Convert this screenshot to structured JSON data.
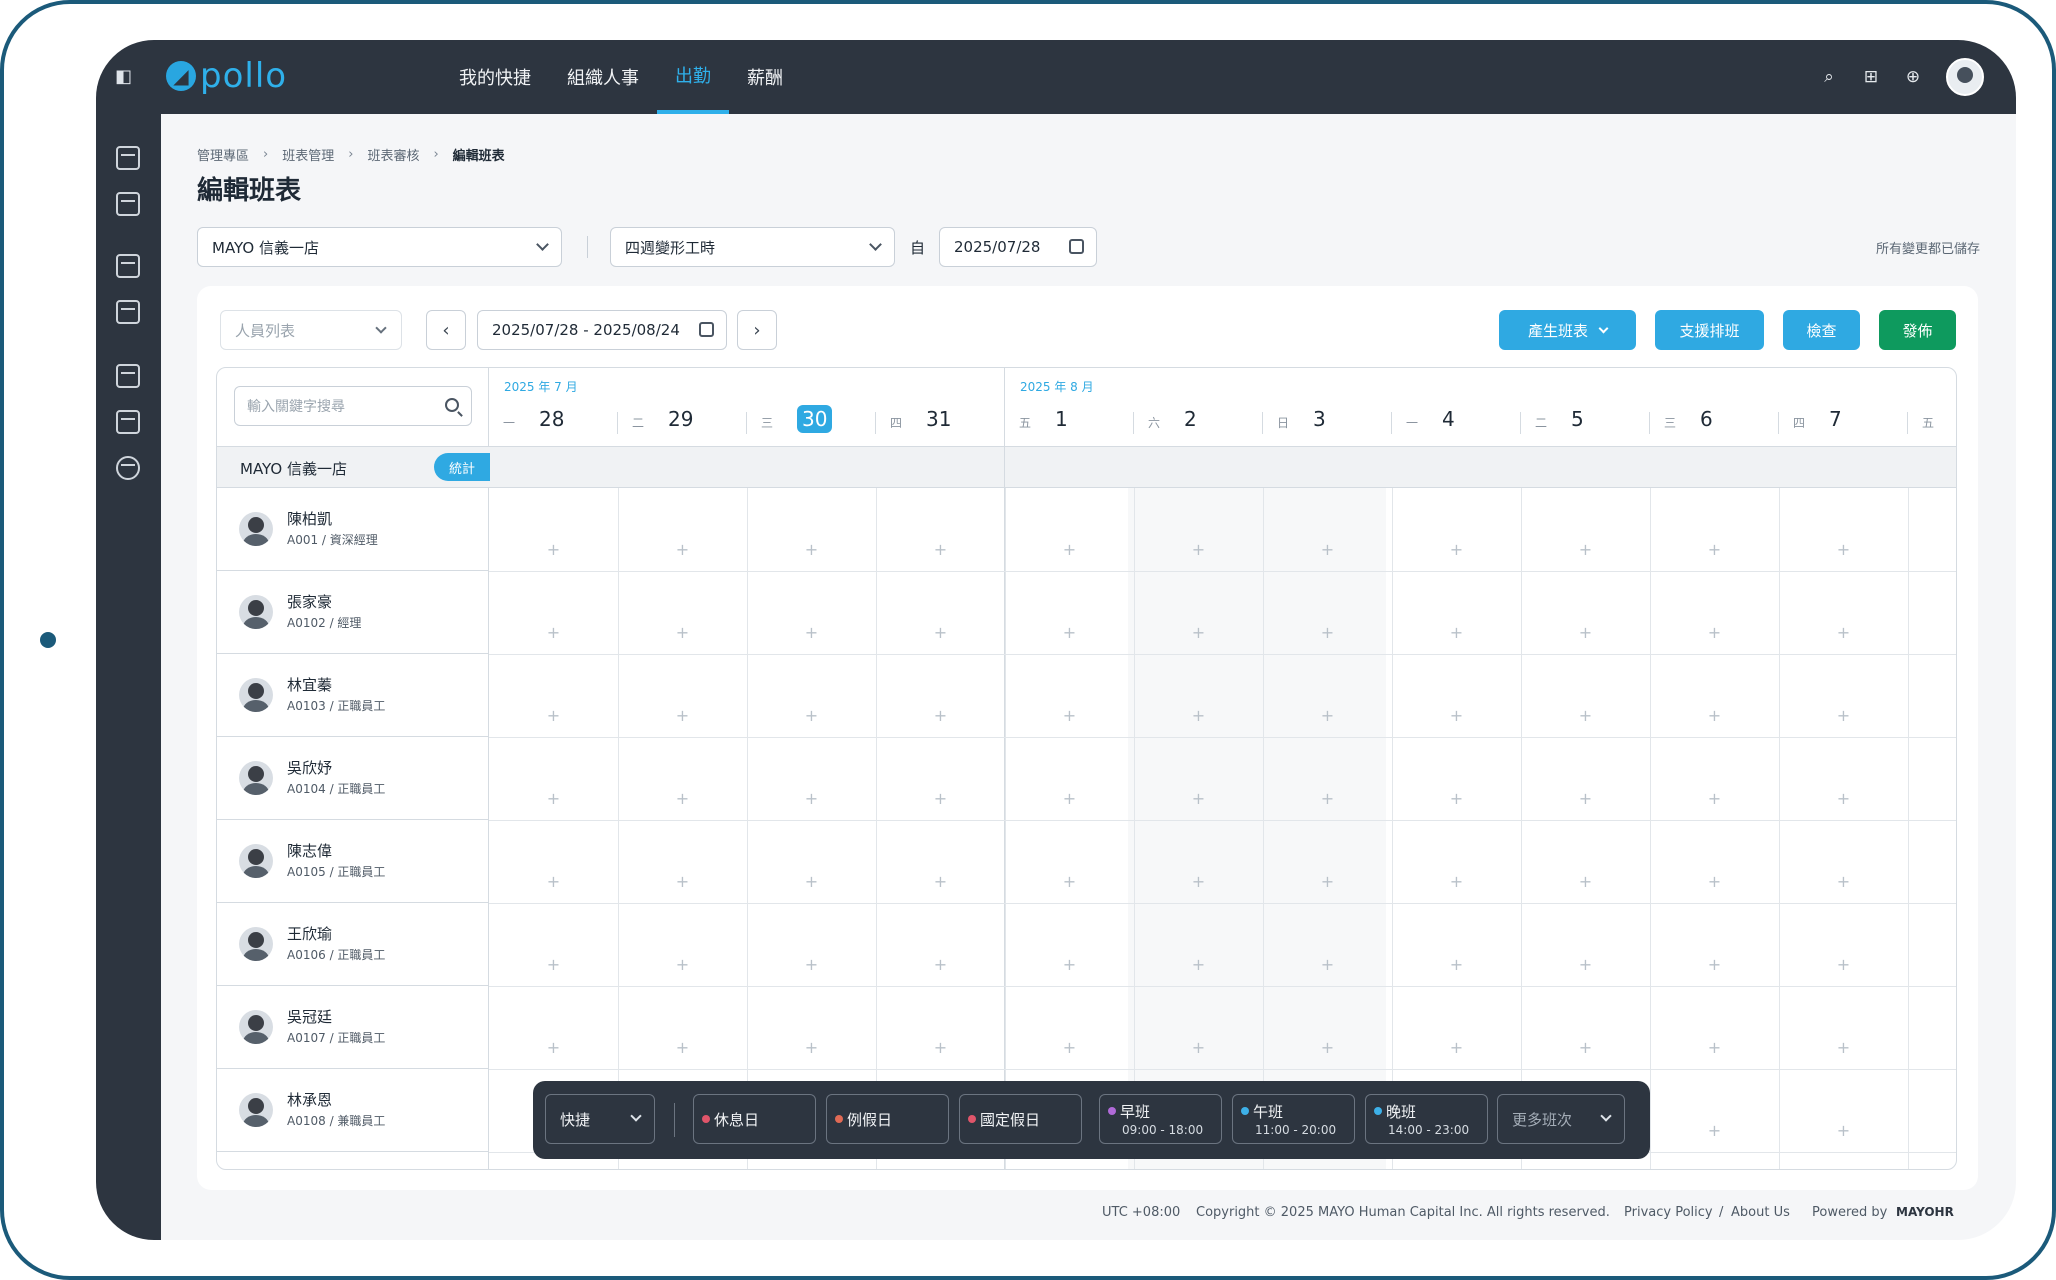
{
  "app": {
    "logo_text": "pollo",
    "brand_color": "#2fa9e2"
  },
  "nav": {
    "items": [
      {
        "label": "我的快捷"
      },
      {
        "label": "組織人事"
      },
      {
        "label": "出勤",
        "active": true
      },
      {
        "label": "薪酬"
      }
    ]
  },
  "breadcrumb": [
    "管理專區",
    "班表管理",
    "班表審核",
    "編輯班表"
  ],
  "page_title": "編輯班表",
  "filters": {
    "store": "MAYO 信義一店",
    "work_type": "四週變形工時",
    "from_label": "自",
    "from_date": "2025/07/28",
    "saved_status": "所有變更都已儲存"
  },
  "toolbar": {
    "people_select_placeholder": "人員列表",
    "date_range": "2025/07/28 - 2025/08/24",
    "generate_label": "產生班表",
    "support_label": "支援排班",
    "check_label": "檢查",
    "publish_label": "發佈"
  },
  "grid": {
    "search_placeholder": "輸入關鍵字搜尋",
    "group_name": "MAYO 信義一店",
    "stats_label": "統計",
    "month_labels": [
      "2025 年 7 月",
      "2025 年 8 月"
    ],
    "days": [
      {
        "weekday": "一",
        "day": "28"
      },
      {
        "weekday": "二",
        "day": "29"
      },
      {
        "weekday": "三",
        "day": "30",
        "today": true
      },
      {
        "weekday": "四",
        "day": "31"
      },
      {
        "weekday": "五",
        "day": "1"
      },
      {
        "weekday": "六",
        "day": "2"
      },
      {
        "weekday": "日",
        "day": "3"
      },
      {
        "weekday": "一",
        "day": "4"
      },
      {
        "weekday": "二",
        "day": "5"
      },
      {
        "weekday": "三",
        "day": "6"
      },
      {
        "weekday": "四",
        "day": "7"
      },
      {
        "weekday": "五",
        "day": ""
      }
    ],
    "employees": [
      {
        "name": "陳柏凱",
        "meta": "A001 / 資深經理"
      },
      {
        "name": "張家豪",
        "meta": "A0102 / 經理"
      },
      {
        "name": "林宜蓁",
        "meta": "A0103 / 正職員工"
      },
      {
        "name": "吳欣妤",
        "meta": "A0104 / 正職員工"
      },
      {
        "name": "陳志偉",
        "meta": "A0105 / 正職員工"
      },
      {
        "name": "王欣瑜",
        "meta": "A0106 / 正職員工"
      },
      {
        "name": "吳冠廷",
        "meta": "A0107 / 正職員工"
      },
      {
        "name": "林承恩",
        "meta": "A0108 / 兼職員工"
      }
    ],
    "add_symbol": "+"
  },
  "quickbar": {
    "mode_label": "快捷",
    "items": [
      {
        "label": "休息日",
        "dot_color": "#e0556a"
      },
      {
        "label": "例假日",
        "dot_color": "#e06a55"
      },
      {
        "label": "國定假日",
        "dot_color": "#e0556a"
      },
      {
        "label": "早班",
        "time": "09:00 - 18:00",
        "dot_color": "#b06ad8"
      },
      {
        "label": "午班",
        "time": "11:00 - 20:00",
        "dot_color": "#3db0e8"
      },
      {
        "label": "晚班",
        "time": "14:00 - 23:00",
        "dot_color": "#3db0e8"
      }
    ],
    "more_label": "更多班次"
  },
  "footer": {
    "timezone": "UTC +08:00",
    "copyright": "Copyright © 2025 MAYO Human Capital Inc. All rights reserved.",
    "privacy": "Privacy Policy",
    "divider": "/",
    "about": "About Us",
    "powered_by": "Powered by",
    "powered_brand": "MAYOHR"
  }
}
